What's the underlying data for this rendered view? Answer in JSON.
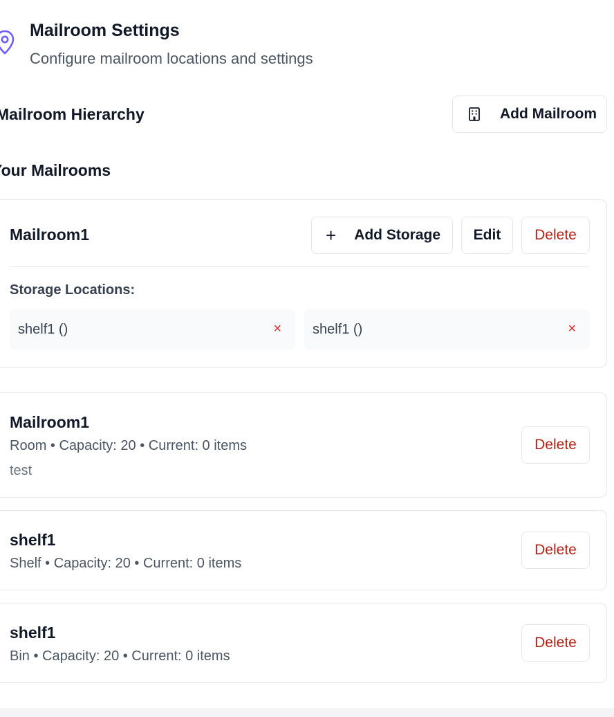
{
  "header": {
    "title": "Mailroom Settings",
    "subtitle": "Configure mailroom locations and settings",
    "icon": "map-pin-icon"
  },
  "hierarchy": {
    "title": "Mailroom Hierarchy",
    "add_mailroom_label": "Add Mailroom",
    "add_mailroom_icon": "building-icon"
  },
  "mailrooms": {
    "title": "Your Mailrooms",
    "card": {
      "name": "Mailroom1",
      "add_storage_label": "Add Storage",
      "edit_label": "Edit",
      "delete_label": "Delete",
      "storage_label": "Storage Locations:",
      "storage": [
        {
          "label": "shelf1 ()",
          "remove": "×"
        },
        {
          "label": "shelf1 ()",
          "remove": "×"
        }
      ]
    }
  },
  "locations": [
    {
      "name": "Mailroom1",
      "meta": "Room • Capacity: 20 • Current: 0 items",
      "description": "test",
      "delete_label": "Delete"
    },
    {
      "name": "shelf1",
      "meta": "Shelf • Capacity: 20 • Current: 0 items",
      "delete_label": "Delete"
    },
    {
      "name": "shelf1",
      "meta": "Bin • Capacity: 20 • Current: 0 items",
      "delete_label": "Delete"
    }
  ],
  "colors": {
    "accent": "#6d5dfc",
    "danger": "#b42318",
    "border": "#e5e7eb"
  }
}
